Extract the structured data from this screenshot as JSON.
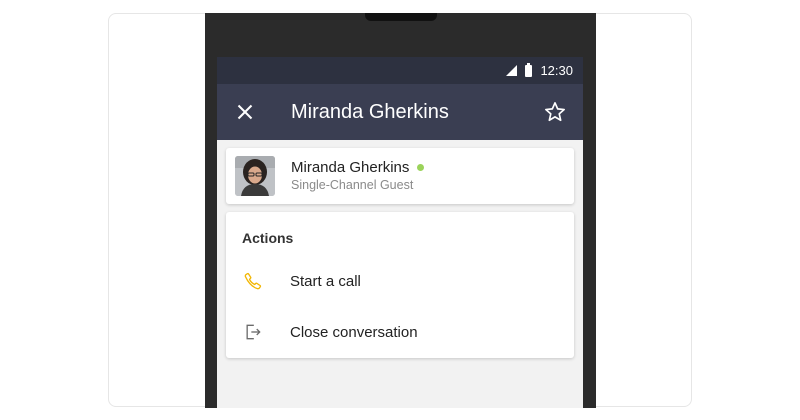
{
  "status_bar": {
    "time": "12:30"
  },
  "app_bar": {
    "title": "Miranda Gherkins"
  },
  "profile": {
    "name": "Miranda Gherkins",
    "subtitle": "Single-Channel Guest",
    "presence": "online",
    "presence_color": "#9bd35a"
  },
  "actions": {
    "heading": "Actions",
    "items": [
      {
        "label": "Start a call",
        "icon": "phone-icon",
        "icon_color": "#f2b705"
      },
      {
        "label": "Close conversation",
        "icon": "exit-icon",
        "icon_color": "#6b6b6b"
      }
    ]
  },
  "colors": {
    "app_bar": "#3a3e52",
    "status_bar": "#2d3140",
    "screen_bg": "#f2f2f2"
  }
}
